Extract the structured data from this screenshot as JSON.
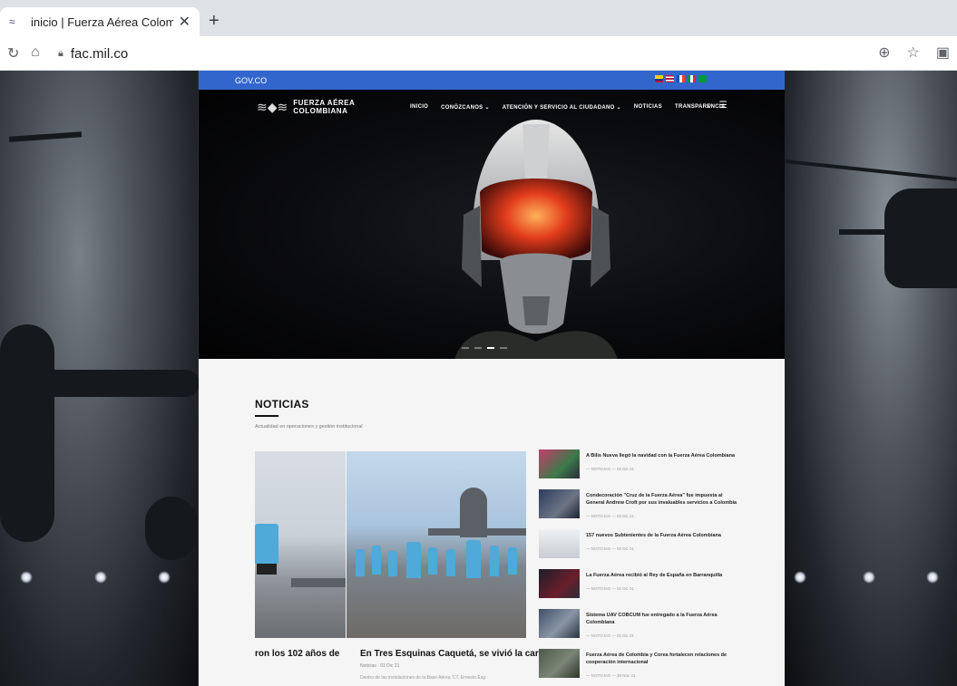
{
  "browser": {
    "tab_title": "inicio | Fuerza Aérea Colombia",
    "tab_close": "✕",
    "new_tab": "+",
    "url": "fac.mil.co"
  },
  "site": {
    "gov_label": "GOV.CO",
    "logo_line1": "FUERZA AÉREA",
    "logo_line2": "COLOMBIANA",
    "menu": [
      "INICIO",
      "CONÓZCANOS ⌄",
      "ATENCIÓN Y SERVICIO AL CIUDADANO ⌄",
      "NOTICIAS",
      "TRANSPARENCIA"
    ],
    "news": {
      "title": "NOTICIAS",
      "subtitle": "Actualidad en operaciones y gestión institucional",
      "slide1_caption": "ron los 102 años de",
      "slide2_caption": "En Tres Esquinas Caquetá, se vivió la carrera",
      "slide2_meta": "Noticias · 01 Dic 21",
      "slide2_excerpt": "Dentro de las instalaciones de la Base Aérea 'CT. Ernesto Esg",
      "items": [
        {
          "title": "A Bilis Nueva llegó la navidad con la Fuerza Aérea Colombiana",
          "meta": "— NOTICIAS — 02 Dic 21"
        },
        {
          "title": "Condecoración \"Cruz de la Fuerza Aérea\" fue impuesta al General Andrew Croft por sus invaluables servicios a Colombia",
          "meta": "— NOTICIAS — 02 Dic 21"
        },
        {
          "title": "157 nuevos Subtenientes de la Fuerza Aérea Colombiana",
          "meta": "— NOTICIAS — 02 Dic 21"
        },
        {
          "title": "La Fuerza Aérea recibió al Rey de España en Barranquilla",
          "meta": "— NOTICIAS — 01 Dic 21"
        },
        {
          "title": "Sistema UAV COBCUM fue entregado a la Fuerza Aérea Colombiana",
          "meta": "— NOTICIAS — 01 Dic 21"
        },
        {
          "title": "Fuerza Aérea de Colombia y Corea fortalecen relaciones de cooperación internacional",
          "meta": "— NOTICIAS — 30 Nov 21"
        }
      ]
    }
  },
  "colors": {
    "gov_blue": "#3366cc",
    "hero_black": "#050506"
  },
  "icons": [
    "reload-icon",
    "home-icon",
    "lock-icon",
    "zoom-icon",
    "star-icon",
    "extension-icon",
    "search-icon",
    "hamburger-icon"
  ]
}
